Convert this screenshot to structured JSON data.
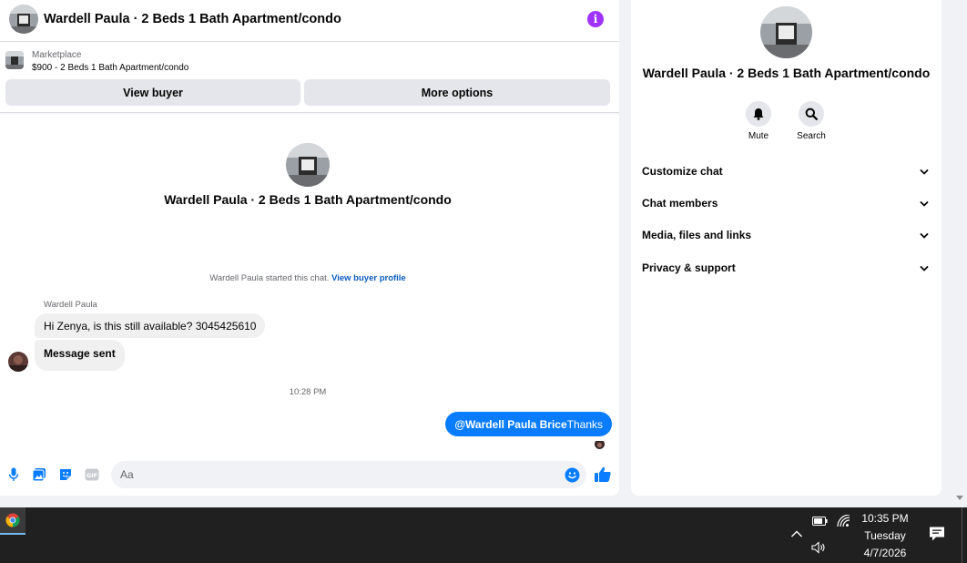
{
  "conversation": {
    "title": "Wardell Paula · 2 Beds 1 Bath Apartment/condo"
  },
  "marketplace": {
    "kicker": "Marketplace",
    "listing": "$900 - 2 Beds 1 Bath Apartment/condo",
    "view_buyer_label": "View buyer",
    "more_options_label": "More options"
  },
  "thread": {
    "intro_title": "Wardell Paula · 2 Beds 1 Bath Apartment/condo",
    "started_text": "Wardell Paula started this chat.",
    "started_link": "View buyer profile",
    "sender_name": "Wardell Paula",
    "messages_in": [
      "Hi Zenya, is this still available? 3045425610",
      "Message sent"
    ],
    "timestamp": "10:28 PM",
    "message_out": {
      "mention": "@Wardell Paula Brice",
      "text": "Thanks"
    }
  },
  "composer": {
    "placeholder": "Aa",
    "icons": [
      "microphone-icon",
      "photo-icon",
      "sticker-icon",
      "gif-icon",
      "emoji-icon",
      "thumbs-up-icon"
    ]
  },
  "info_panel": {
    "title": "Wardell Paula · 2 Beds 1 Bath Apartment/condo",
    "actions": [
      {
        "label": "Mute",
        "icon": "bell-icon"
      },
      {
        "label": "Search",
        "icon": "search-icon"
      }
    ],
    "sections": [
      "Customize chat",
      "Chat members",
      "Media, files and links",
      "Privacy & support"
    ]
  },
  "taskbar": {
    "time": "10:35 PM",
    "day": "Tuesday",
    "date": "4/7/2026"
  },
  "colors": {
    "accent_blue": "#0a7cff",
    "info_purple": "#a033ff",
    "link_blue": "#0a5dc2",
    "taskbar": "#202020"
  }
}
